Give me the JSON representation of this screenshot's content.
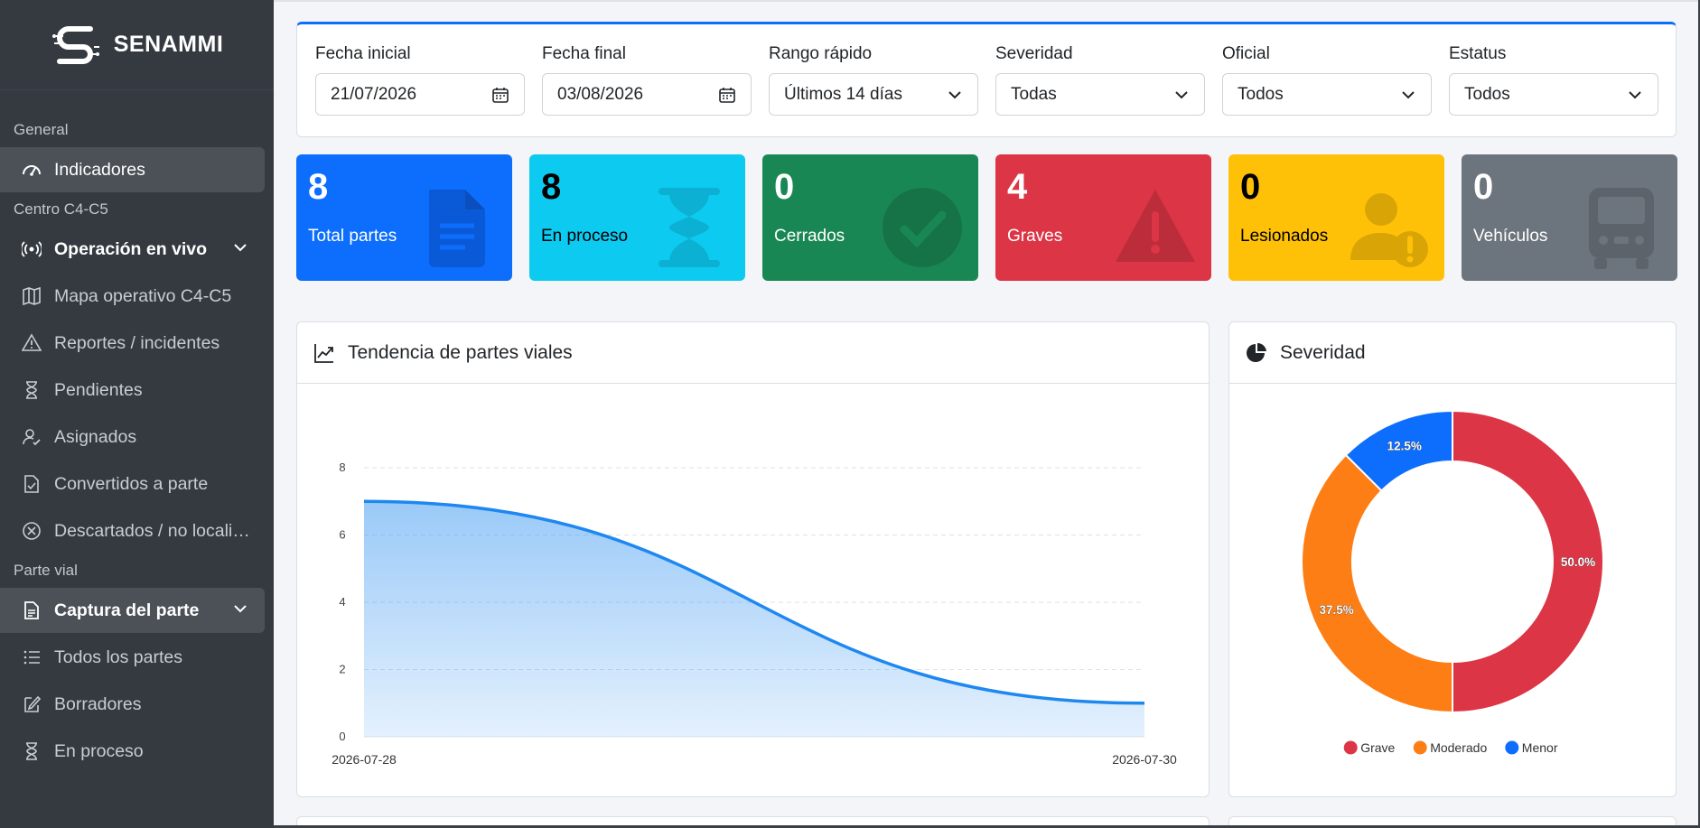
{
  "app": {
    "brand_name": "SENAMMI"
  },
  "sidebar": {
    "sections": {
      "general": "General",
      "centro": "Centro C4-C5",
      "parte_vial": "Parte vial"
    },
    "items": {
      "indicadores": "Indicadores",
      "operacion": "Operación en vivo",
      "mapa": "Mapa operativo C4-C5",
      "reportes": "Reportes / incidentes",
      "pendientes": "Pendientes",
      "asignados": "Asignados",
      "convertidos": "Convertidos a parte",
      "descartados": "Descartados / no locali…",
      "captura": "Captura del parte",
      "todos": "Todos los partes",
      "borradores": "Borradores",
      "en_proceso": "En proceso"
    }
  },
  "filters": {
    "fecha_inicial": {
      "label": "Fecha inicial",
      "value": "21/07/2026"
    },
    "fecha_final": {
      "label": "Fecha final",
      "value": "03/08/2026"
    },
    "rango": {
      "label": "Rango rápido",
      "value": "Últimos 14 días"
    },
    "severidad": {
      "label": "Severidad",
      "value": "Todas"
    },
    "oficial": {
      "label": "Oficial",
      "value": "Todos"
    },
    "estatus": {
      "label": "Estatus",
      "value": "Todos"
    }
  },
  "stats": {
    "total": {
      "value": "8",
      "label": "Total partes",
      "color": "#0d6efd"
    },
    "proceso": {
      "value": "8",
      "label": "En proceso",
      "color": "#0dcaf0"
    },
    "cerrados": {
      "value": "0",
      "label": "Cerrados",
      "color": "#198754"
    },
    "graves": {
      "value": "4",
      "label": "Graves",
      "color": "#dc3545"
    },
    "lesionados": {
      "value": "0",
      "label": "Lesionados",
      "color": "#ffc107"
    },
    "vehiculos": {
      "value": "0",
      "label": "Vehículos",
      "color": "#6c757d"
    }
  },
  "panels": {
    "tendencia": "Tendencia de partes viales",
    "severidad": "Severidad"
  },
  "chart_data": [
    {
      "type": "area",
      "x": [
        "2026-07-28",
        "2026-07-30"
      ],
      "values": [
        7,
        1
      ],
      "ylim": [
        0,
        8
      ],
      "yticks": [
        0,
        2,
        4,
        6,
        8
      ],
      "color": "#1e88f0",
      "grid": true,
      "title": "",
      "xlabel": "",
      "ylabel": ""
    },
    {
      "type": "pie",
      "series": [
        {
          "name": "Grave",
          "value": 50.0,
          "label": "50.0%",
          "color": "#dc3545"
        },
        {
          "name": "Moderado",
          "value": 37.5,
          "label": "37.5%",
          "color": "#fd7e14"
        },
        {
          "name": "Menor",
          "value": 12.5,
          "label": "12.5%",
          "color": "#0d6efd"
        }
      ],
      "legend": "bottom"
    }
  ]
}
